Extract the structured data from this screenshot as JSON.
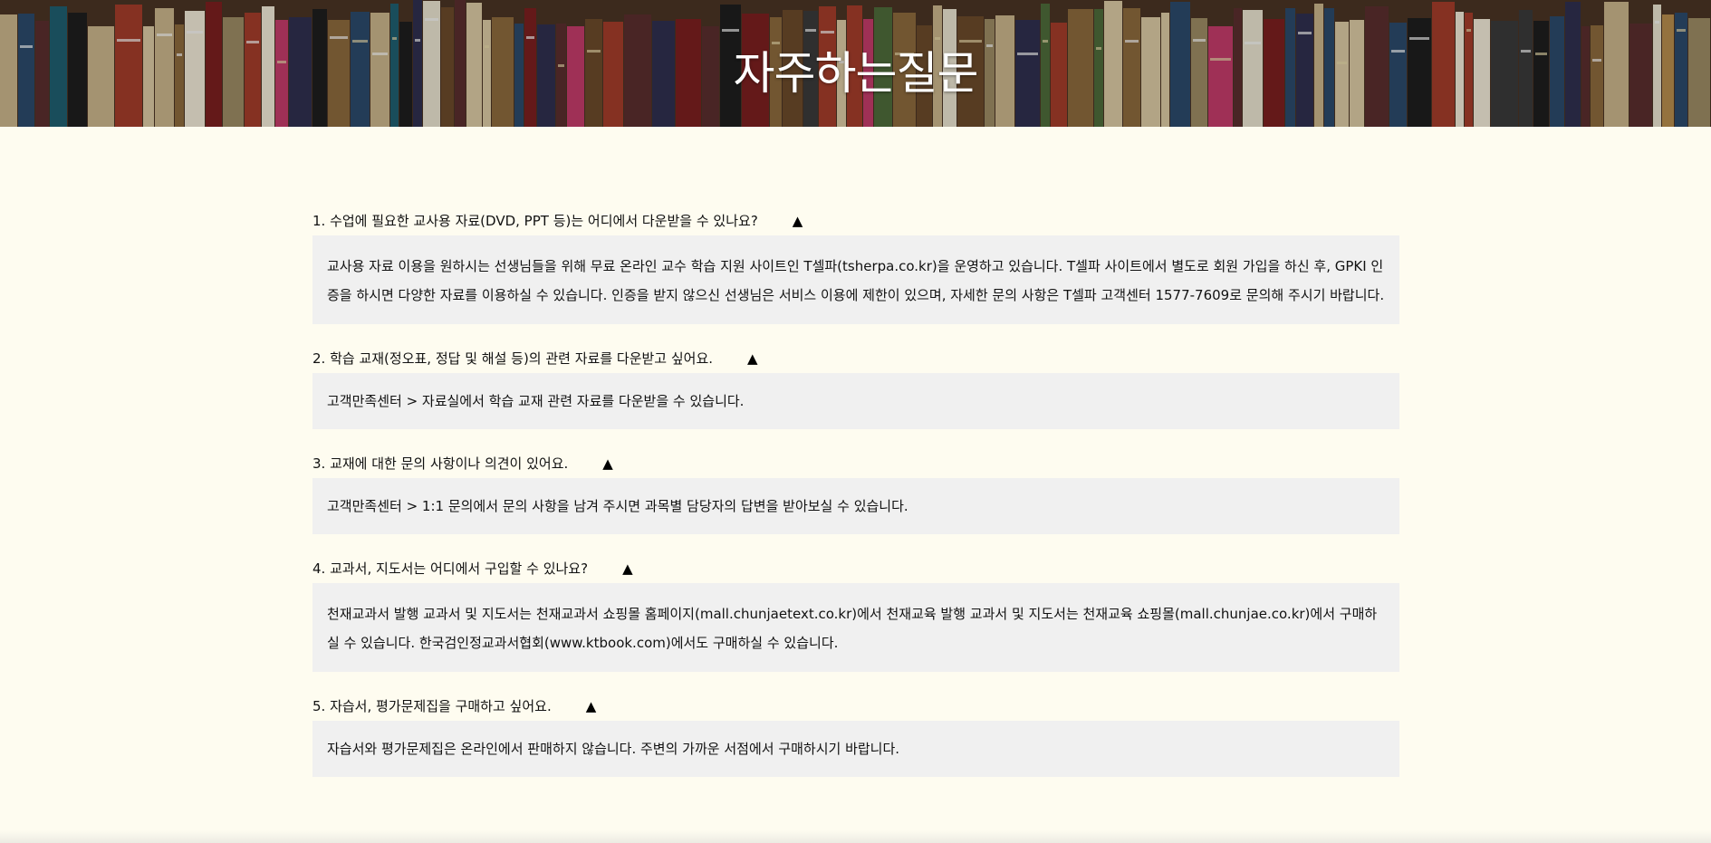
{
  "hero": {
    "title": "자주하는질문",
    "image": "bookshelf-banner"
  },
  "colors": {
    "page_background": "#fefcf0",
    "answer_background": "#f0f0f0",
    "text": "#111111",
    "hero_title": "#ffffff"
  },
  "faq": [
    {
      "question": "1. 수업에 필요한 교사용 자료(DVD, PPT 등)는 어디에서 다운받을 수 있나요?",
      "toggle": "▲",
      "answer": "교사용 자료 이용을 원하시는 선생님들을 위해 무료 온라인 교수 학습 지원 사이트인 T셀파(tsherpa.co.kr)을 운영하고 있습니다. T셀파 사이트에서 별도로 회원 가입을 하신 후, GPKI 인증을 하시면 다양한 자료를 이용하실 수 있습니다. 인증을 받지 않으신 선생님은 서비스 이용에 제한이 있으며, 자세한 문의 사항은 T셀파 고객센터 1577-7609로 문의해 주시기 바랍니다."
    },
    {
      "question": "2. 학습 교재(정오표, 정답 및 해설 등)의 관련 자료를 다운받고 싶어요.",
      "toggle": "▲",
      "answer": "고객만족센터 > 자료실에서 학습 교재 관련 자료를 다운받을 수 있습니다."
    },
    {
      "question": "3. 교재에 대한 문의 사항이나 의견이 있어요.",
      "toggle": "▲",
      "answer": "고객만족센터 > 1:1 문의에서 문의 사항을 남겨 주시면 과목별 담당자의 답변을 받아보실 수 있습니다."
    },
    {
      "question": "4. 교과서, 지도서는 어디에서 구입할 수 있나요?",
      "toggle": "▲",
      "answer": "천재교과서 발행 교과서 및 지도서는 천재교과서 쇼핑몰 홈페이지(mall.chunjaetext.co.kr)에서 천재교육 발행 교과서 및 지도서는 천재교육 쇼핑몰(mall.chunjae.co.kr)에서 구매하실 수 있습니다. 한국검인정교과서협회(www.ktbook.com)에서도 구매하실 수 있습니다."
    },
    {
      "question": "5. 자습서, 평가문제집을 구매하고 싶어요.",
      "toggle": "▲",
      "answer": "자습서와 평가문제집은 온라인에서 판매하지 않습니다. 주변의 가까운 서점에서 구매하시기 바랍니다."
    }
  ]
}
